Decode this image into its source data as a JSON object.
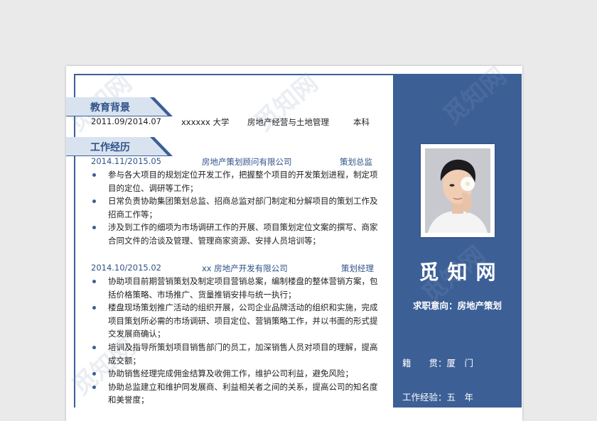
{
  "sections": {
    "education": {
      "title": "教育背景"
    },
    "work": {
      "title": "工作经历"
    }
  },
  "education": {
    "period": "2011.09/2014.07",
    "school": "xxxxxx 大学",
    "major": "房地产经营与土地管理",
    "degree": "本科"
  },
  "jobs": [
    {
      "period": "2014.11/2015.05",
      "company": "房地产策划顾问有限公司",
      "title": "策划总监",
      "duties": [
        "参与各大项目的规划定位开发工作，把握整个项目的开发策划进程，制定项目的定位、调研等工作；",
        "日常负责协助集团策划总监、招商总监对部门制定和分解项目的策划工作及招商工作等；",
        "涉及到工作的细项为市场调研工作的开展、项目策划定位文案的撰写、商家合同文件的洽谈及管理、管理商家资源、安排人员培训等；"
      ]
    },
    {
      "period": "2014.10/2015.02",
      "company": "xx 房地产开发有限公司",
      "title": "策划经理",
      "duties": [
        "协助项目前期营销策划及制定项目营销总案，编制楼盘的整体营销方案，包括价格策略、市场推广、货量推销安排与统一执行；",
        "楼盘现场策划推广活动的组织开展，公司企业品牌活动的组织和实施，完成项目策划所必需的市场调研、项目定位、营销策略工作，并以书面的形式提交发展商确认；",
        "培训及指导所策划项目销售部门的员工，加深销售人员对项目的理解，提高成交额；",
        "协助销售经理完成佣金结算及收佣工作，维护公司利益，避免风险；",
        "协助总监建立和维护同发展商、利益相关者之间的关系，提高公司的知名度和美誉度；"
      ]
    }
  ],
  "profile": {
    "name": "觅知网",
    "intent": "求职意向：房地产策划",
    "hometown_label": "籍　　贯：",
    "hometown_value": "厦　门",
    "experience_label": "工作经验：",
    "experience_value": "五　年"
  },
  "watermark": "觅知网",
  "colors": {
    "accent": "#3c5f96",
    "band": "#d9e3f0"
  }
}
